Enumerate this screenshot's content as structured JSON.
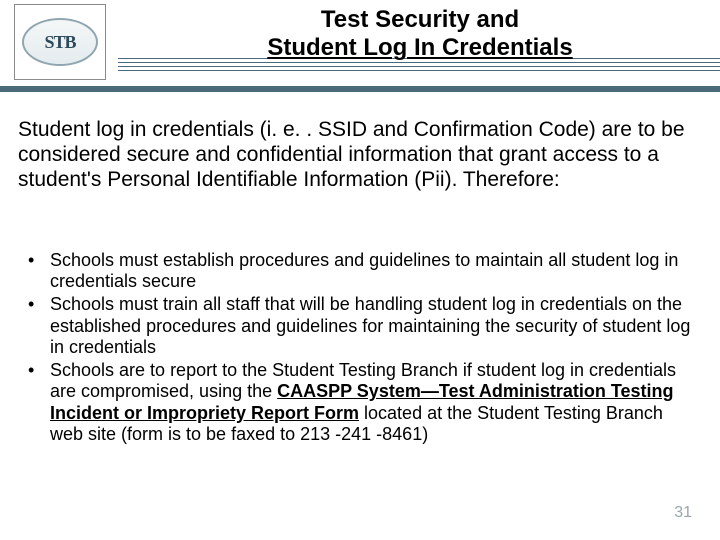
{
  "logo": {
    "text": "STB"
  },
  "title": {
    "line1": "Test Security and",
    "line2": "Student Log In Credentials"
  },
  "intro": "Student log in credentials (i. e. . SSID and Confirmation Code) are to be considered secure and confidential information that grant access to a student's Personal Identifiable Information (Pii).  Therefore:",
  "bullets": [
    "Schools must establish procedures and guidelines to maintain all student log in credentials secure",
    "Schools must train all staff that will be handling student log in credentials on the established procedures and guidelines for maintaining the security of student log in credentials",
    {
      "pre": "Schools are to report to the Student Testing Branch if student log in credentials are compromised, using the ",
      "boldUnderline": "CAASPP System—Test Administration Testing Incident or Impropriety Report Form",
      "post": " located at the Student Testing Branch web site (form is to be faxed to 213 -241 -8461)"
    }
  ],
  "pageNumber": "31"
}
